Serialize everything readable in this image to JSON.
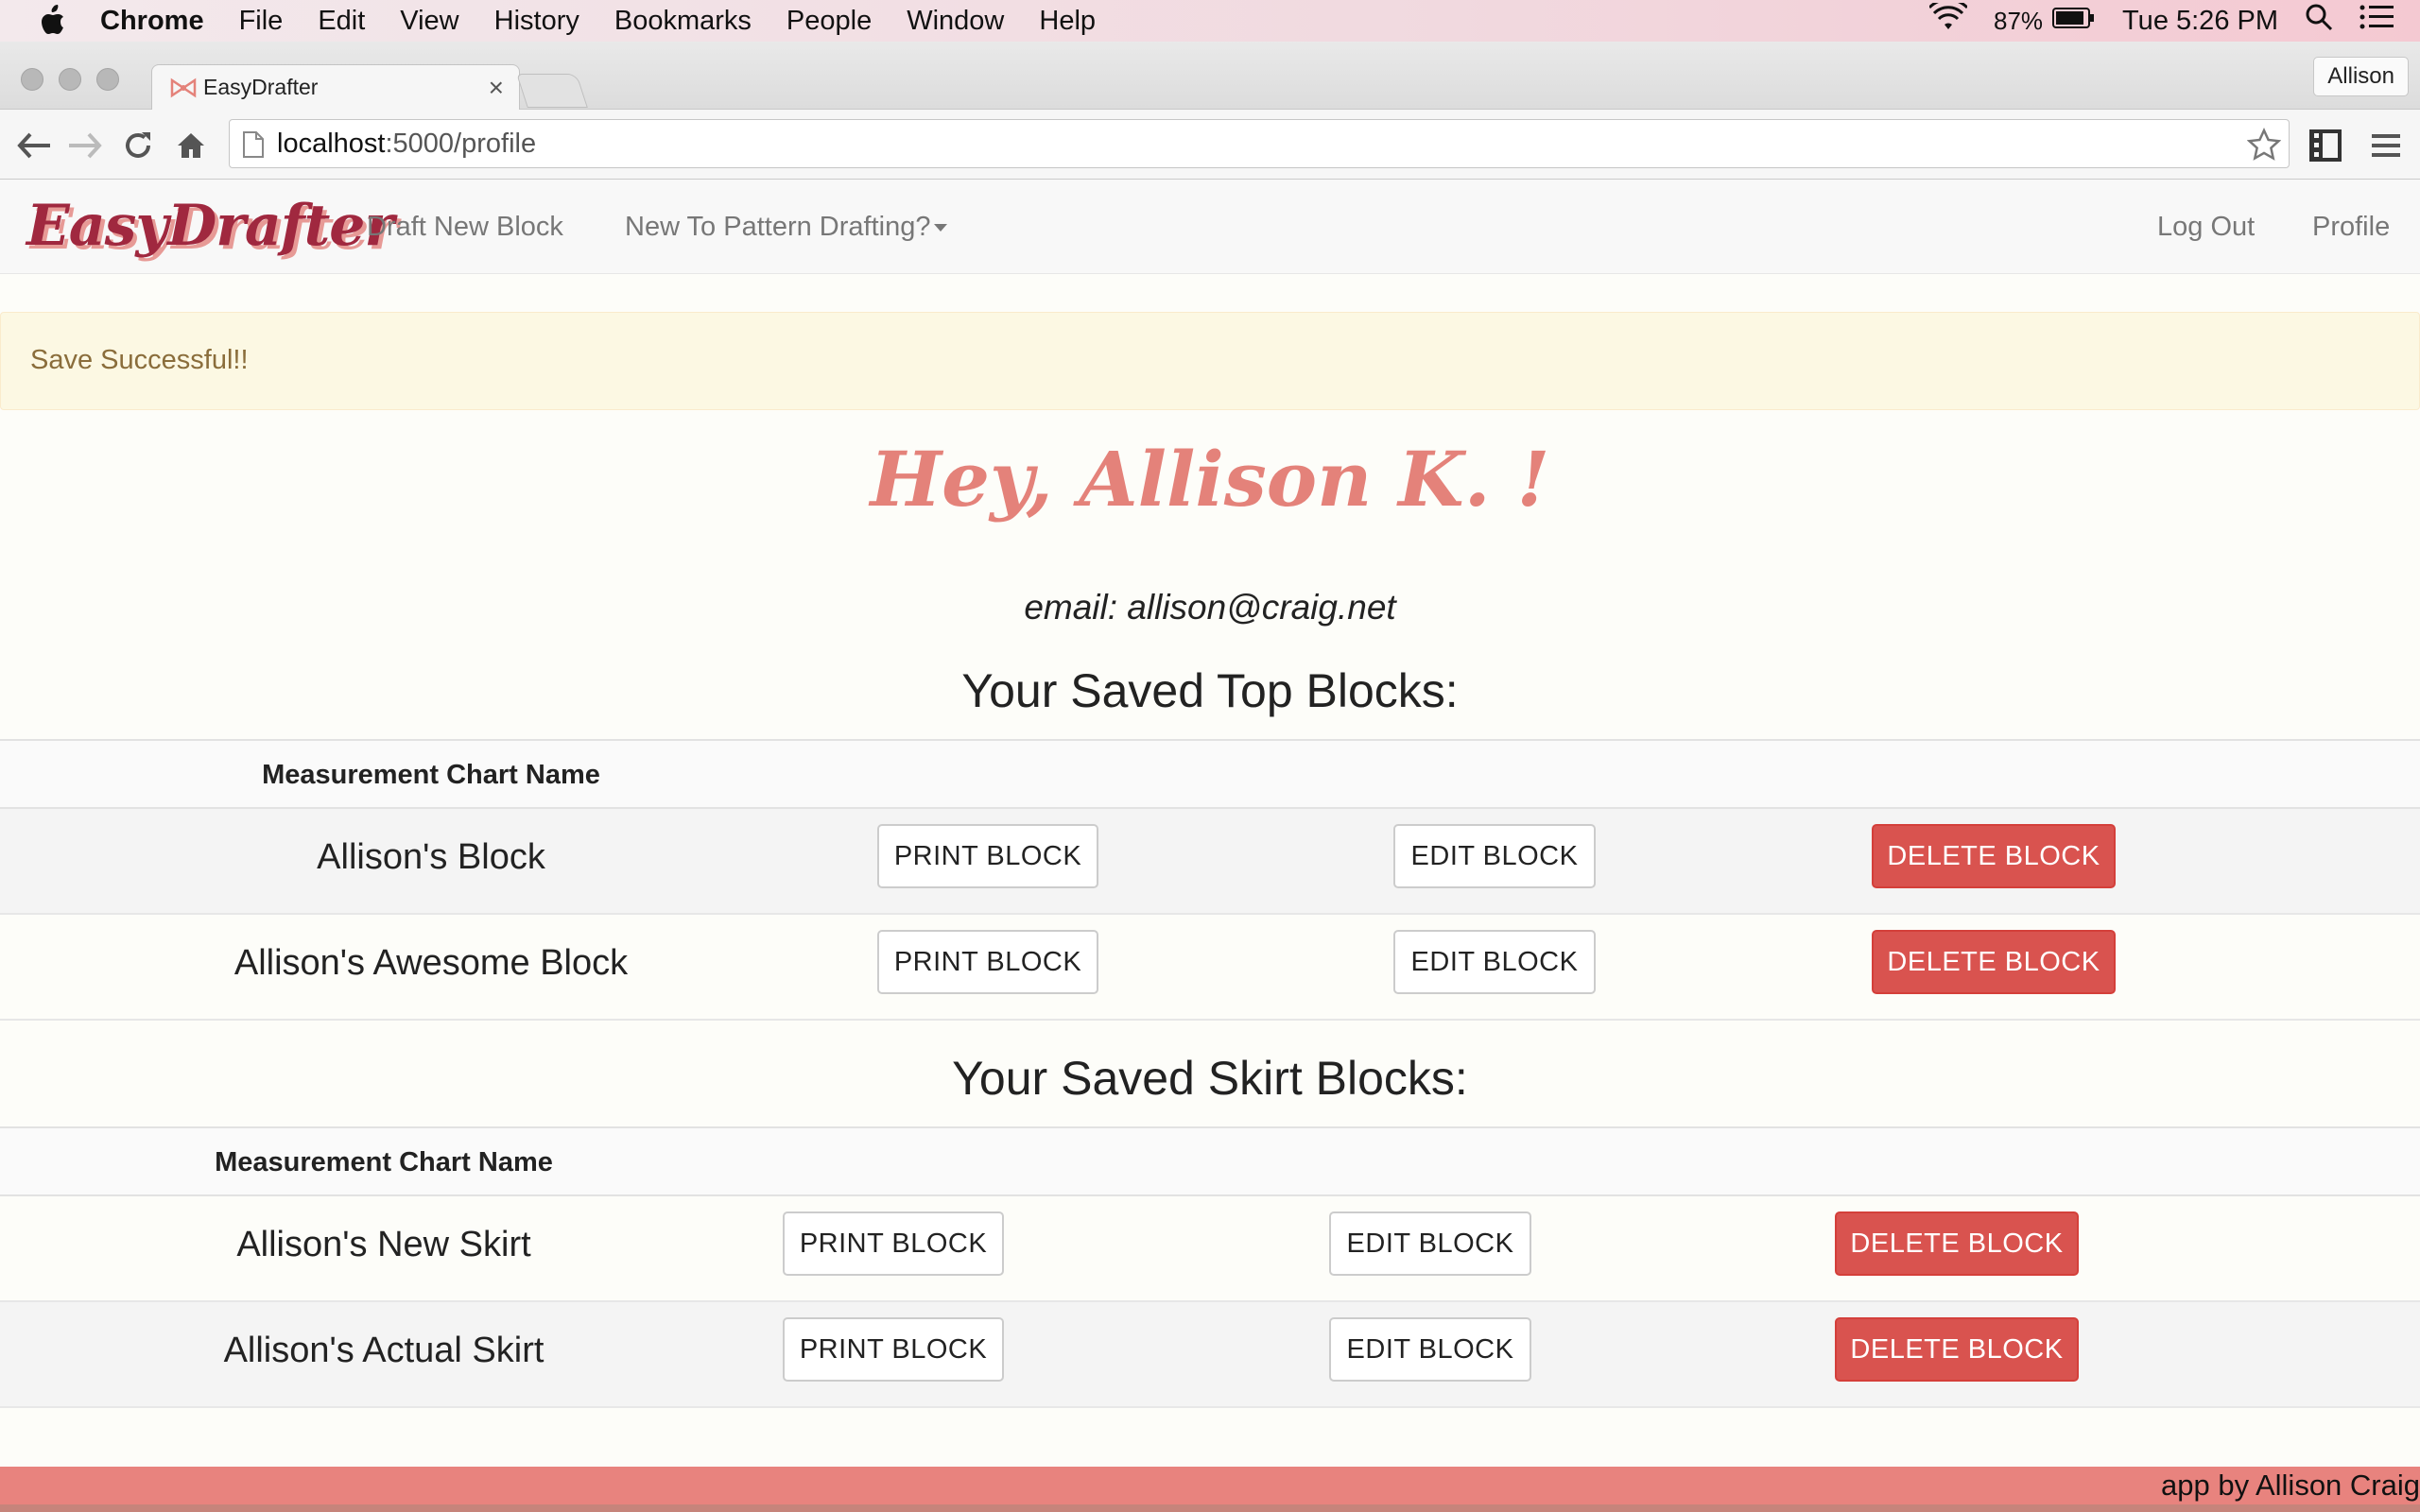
{
  "menubar": {
    "app": "Chrome",
    "items": [
      "File",
      "Edit",
      "View",
      "History",
      "Bookmarks",
      "People",
      "Window",
      "Help"
    ],
    "battery": "87%",
    "clock": "Tue 5:26 PM"
  },
  "browser": {
    "tab_title": "EasyDrafter",
    "profile_name": "Allison",
    "url_host": "localhost",
    "url_path": ":5000/profile"
  },
  "site": {
    "logo": "EasyDrafter",
    "nav": {
      "draft": "Draft New Block",
      "new_to": "New To Pattern Drafting?",
      "logout": "Log Out",
      "profile": "Profile"
    },
    "alert": "Save Successful!!",
    "greeting": "Hey, Allison K. !",
    "email": "email: allison@craig.net",
    "top_section": {
      "title": "Your Saved Top Blocks:",
      "header": "Measurement Chart Name",
      "rows": [
        {
          "name": "Allison's Block",
          "print": "PRINT BLOCK",
          "edit": "EDIT BLOCK",
          "delete": "DELETE BLOCK"
        },
        {
          "name": "Allison's Awesome Block",
          "print": "PRINT BLOCK",
          "edit": "EDIT BLOCK",
          "delete": "DELETE BLOCK"
        }
      ]
    },
    "skirt_section": {
      "title": "Your Saved Skirt Blocks:",
      "header": "Measurement Chart Name",
      "rows": [
        {
          "name": "Allison's New Skirt",
          "print": "PRINT BLOCK",
          "edit": "EDIT BLOCK",
          "delete": "DELETE BLOCK"
        },
        {
          "name": "Allison's Actual Skirt",
          "print": "PRINT BLOCK",
          "edit": "EDIT BLOCK",
          "delete": "DELETE BLOCK"
        }
      ]
    },
    "footer": "app by Allison Craig"
  },
  "colors": {
    "logo": "#a0283f",
    "greeting": "#e4827a",
    "danger": "#d9534f",
    "footer": "#e8837e",
    "alert_bg": "#fcf8e3"
  }
}
